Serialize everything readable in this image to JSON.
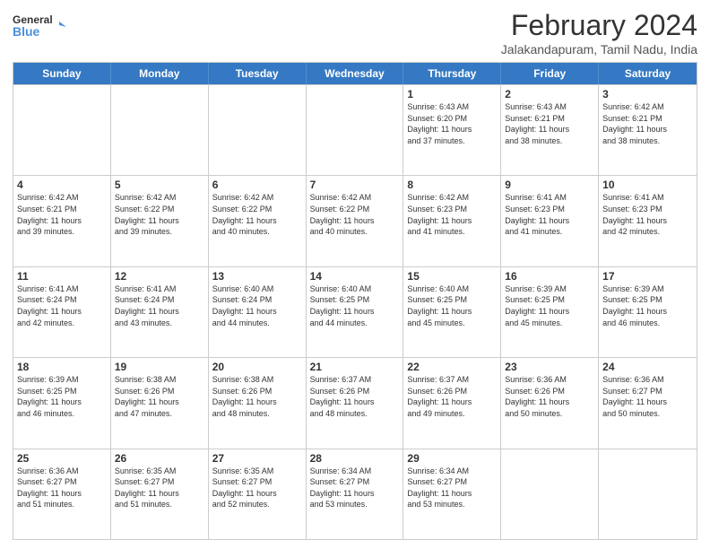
{
  "header": {
    "logo_line1": "General",
    "logo_line2": "Blue",
    "month_title": "February 2024",
    "subtitle": "Jalakandapuram, Tamil Nadu, India"
  },
  "days_of_week": [
    "Sunday",
    "Monday",
    "Tuesday",
    "Wednesday",
    "Thursday",
    "Friday",
    "Saturday"
  ],
  "weeks": [
    [
      {
        "day": "",
        "info": ""
      },
      {
        "day": "",
        "info": ""
      },
      {
        "day": "",
        "info": ""
      },
      {
        "day": "",
        "info": ""
      },
      {
        "day": "1",
        "info": "Sunrise: 6:43 AM\nSunset: 6:20 PM\nDaylight: 11 hours\nand 37 minutes."
      },
      {
        "day": "2",
        "info": "Sunrise: 6:43 AM\nSunset: 6:21 PM\nDaylight: 11 hours\nand 38 minutes."
      },
      {
        "day": "3",
        "info": "Sunrise: 6:42 AM\nSunset: 6:21 PM\nDaylight: 11 hours\nand 38 minutes."
      }
    ],
    [
      {
        "day": "4",
        "info": "Sunrise: 6:42 AM\nSunset: 6:21 PM\nDaylight: 11 hours\nand 39 minutes."
      },
      {
        "day": "5",
        "info": "Sunrise: 6:42 AM\nSunset: 6:22 PM\nDaylight: 11 hours\nand 39 minutes."
      },
      {
        "day": "6",
        "info": "Sunrise: 6:42 AM\nSunset: 6:22 PM\nDaylight: 11 hours\nand 40 minutes."
      },
      {
        "day": "7",
        "info": "Sunrise: 6:42 AM\nSunset: 6:22 PM\nDaylight: 11 hours\nand 40 minutes."
      },
      {
        "day": "8",
        "info": "Sunrise: 6:42 AM\nSunset: 6:23 PM\nDaylight: 11 hours\nand 41 minutes."
      },
      {
        "day": "9",
        "info": "Sunrise: 6:41 AM\nSunset: 6:23 PM\nDaylight: 11 hours\nand 41 minutes."
      },
      {
        "day": "10",
        "info": "Sunrise: 6:41 AM\nSunset: 6:23 PM\nDaylight: 11 hours\nand 42 minutes."
      }
    ],
    [
      {
        "day": "11",
        "info": "Sunrise: 6:41 AM\nSunset: 6:24 PM\nDaylight: 11 hours\nand 42 minutes."
      },
      {
        "day": "12",
        "info": "Sunrise: 6:41 AM\nSunset: 6:24 PM\nDaylight: 11 hours\nand 43 minutes."
      },
      {
        "day": "13",
        "info": "Sunrise: 6:40 AM\nSunset: 6:24 PM\nDaylight: 11 hours\nand 44 minutes."
      },
      {
        "day": "14",
        "info": "Sunrise: 6:40 AM\nSunset: 6:25 PM\nDaylight: 11 hours\nand 44 minutes."
      },
      {
        "day": "15",
        "info": "Sunrise: 6:40 AM\nSunset: 6:25 PM\nDaylight: 11 hours\nand 45 minutes."
      },
      {
        "day": "16",
        "info": "Sunrise: 6:39 AM\nSunset: 6:25 PM\nDaylight: 11 hours\nand 45 minutes."
      },
      {
        "day": "17",
        "info": "Sunrise: 6:39 AM\nSunset: 6:25 PM\nDaylight: 11 hours\nand 46 minutes."
      }
    ],
    [
      {
        "day": "18",
        "info": "Sunrise: 6:39 AM\nSunset: 6:25 PM\nDaylight: 11 hours\nand 46 minutes."
      },
      {
        "day": "19",
        "info": "Sunrise: 6:38 AM\nSunset: 6:26 PM\nDaylight: 11 hours\nand 47 minutes."
      },
      {
        "day": "20",
        "info": "Sunrise: 6:38 AM\nSunset: 6:26 PM\nDaylight: 11 hours\nand 48 minutes."
      },
      {
        "day": "21",
        "info": "Sunrise: 6:37 AM\nSunset: 6:26 PM\nDaylight: 11 hours\nand 48 minutes."
      },
      {
        "day": "22",
        "info": "Sunrise: 6:37 AM\nSunset: 6:26 PM\nDaylight: 11 hours\nand 49 minutes."
      },
      {
        "day": "23",
        "info": "Sunrise: 6:36 AM\nSunset: 6:26 PM\nDaylight: 11 hours\nand 50 minutes."
      },
      {
        "day": "24",
        "info": "Sunrise: 6:36 AM\nSunset: 6:27 PM\nDaylight: 11 hours\nand 50 minutes."
      }
    ],
    [
      {
        "day": "25",
        "info": "Sunrise: 6:36 AM\nSunset: 6:27 PM\nDaylight: 11 hours\nand 51 minutes."
      },
      {
        "day": "26",
        "info": "Sunrise: 6:35 AM\nSunset: 6:27 PM\nDaylight: 11 hours\nand 51 minutes."
      },
      {
        "day": "27",
        "info": "Sunrise: 6:35 AM\nSunset: 6:27 PM\nDaylight: 11 hours\nand 52 minutes."
      },
      {
        "day": "28",
        "info": "Sunrise: 6:34 AM\nSunset: 6:27 PM\nDaylight: 11 hours\nand 53 minutes."
      },
      {
        "day": "29",
        "info": "Sunrise: 6:34 AM\nSunset: 6:27 PM\nDaylight: 11 hours\nand 53 minutes."
      },
      {
        "day": "",
        "info": ""
      },
      {
        "day": "",
        "info": ""
      }
    ]
  ]
}
